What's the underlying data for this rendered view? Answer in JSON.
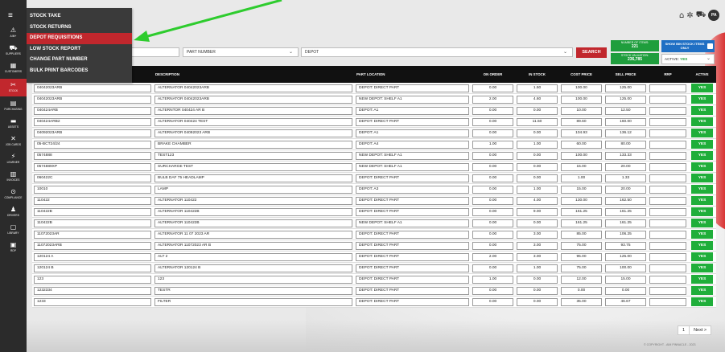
{
  "sidebar": {
    "items": [
      {
        "icon": "⚠",
        "label": "AIM+"
      },
      {
        "icon": "⛟",
        "label": "SUPPLIERS"
      },
      {
        "icon": "▦",
        "label": "CUSTOMERS"
      },
      {
        "icon": "✂",
        "label": "STOCK"
      },
      {
        "icon": "▤",
        "label": "PURCHASING"
      },
      {
        "icon": "▬",
        "label": "ASSETS"
      },
      {
        "icon": "✕",
        "label": "JOB CARDS"
      },
      {
        "icon": "⚡",
        "label": "LEARNER"
      },
      {
        "icon": "▥",
        "label": "INVOICES"
      },
      {
        "icon": "⊙",
        "label": "COMPLIANCE"
      },
      {
        "icon": "♟",
        "label": "DRIVERS"
      },
      {
        "icon": "▢",
        "label": "LIBRARY"
      },
      {
        "icon": "▣",
        "label": "RDP"
      }
    ]
  },
  "stock_menu": {
    "items": [
      "STOCK TAKE",
      "STOCK RETURNS",
      "DEPOT REQUISITIONS",
      "LOW STOCK REPORT",
      "CHANGE PART NUMBER",
      "BULK PRINT BARCODES"
    ],
    "highlighted_index": 2
  },
  "header": {
    "avatar_initials": "PA",
    "icons": [
      "home-icon",
      "settings-icon",
      "truck-icon"
    ]
  },
  "filters": {
    "part_number_placeholder": "PART NUMBER",
    "depot_value": "DEPOT",
    "search_label": "SEARCH"
  },
  "summary": {
    "num_items_label": "NUMBER OF ITEMS:",
    "num_items_value": "221",
    "stock_valuation_label": "STOCK VALUATION:",
    "stock_valuation_value": "236,785",
    "bin_stock_label": "SHOW BIN STOCK ITEMS ONLY",
    "active_label": "ACTIVE:",
    "active_value": "YES"
  },
  "colors": {
    "accent_red": "#c1272d",
    "active_green": "#1fae3a",
    "sidebar_dark": "#2b2b2b",
    "arrow_green": "#2ecc2e"
  },
  "table": {
    "headers": [
      "DESCRIPTION",
      "PART LOCATION",
      "ON ORDER",
      "IN STOCK",
      "COST PRICE",
      "SELL PRICE",
      "RRP",
      "ACTIVE"
    ],
    "rows": [
      [
        "04042023ARB",
        "ALTERNATOR 04042023ARB",
        "DEPOT: DIRECT PART",
        "0.00",
        "1.50",
        "100.00",
        "125.00",
        "",
        "YES"
      ],
      [
        "04042023ARB",
        "ALTERNATOR 04042023ARB",
        "NEW DEPOT: SHELF A1",
        "2.00",
        "4.60",
        "100.00",
        "125.00",
        "",
        "YES"
      ],
      [
        "040424ARB",
        "ALTERNTOR 040424 AR B",
        "DEPOT: A1",
        "0.00",
        "0.00",
        "10.00",
        "12.50",
        "",
        "YES"
      ],
      [
        "040424ARB2",
        "ALTERNATOR 040424 TEST",
        "DEPOT: DIRECT PART",
        "0.00",
        "11.50",
        "89.60",
        "160.00",
        "",
        "YES"
      ],
      [
        "04092023ARB",
        "ALTERNATOR 04092023 ARB",
        "DEPOT: A1",
        "0.00",
        "0.00",
        "104.93",
        "136.12",
        "",
        "YES"
      ],
      [
        "05-BCT24/24",
        "BRAKE CHAMBER",
        "DEPOT: A4",
        "1.00",
        "1.00",
        "60.00",
        "80.00",
        "",
        "YES"
      ],
      [
        "0574888",
        "TEST123",
        "NEW DEPOT: SHELF A1",
        "0.00",
        "0.00",
        "100.00",
        "133.33",
        "",
        "YES"
      ],
      [
        "0574889XP",
        "SURCHARGE TEST",
        "NEW DEPOT: SHELF A1",
        "0.00",
        "0.00",
        "15.00",
        "20.00",
        "",
        "YES"
      ],
      [
        "060422C",
        "BULB DAF 75 HEADLAMP",
        "DEPOT: DIRECT PART",
        "0.00",
        "0.00",
        "1.00",
        "1.33",
        "",
        "YES"
      ],
      [
        "10010",
        "LAMP",
        "DEPOT: A3",
        "0.00",
        "1.00",
        "15.00",
        "20.00",
        "",
        "YES"
      ],
      [
        "110422",
        "ALTERNATOR 110422",
        "DEPOT: DIRECT PART",
        "0.00",
        "4.00",
        "130.00",
        "162.50",
        "",
        "YES"
      ],
      [
        "110422B",
        "ALTERNATOR 110422B",
        "DEPOT: DIRECT PART",
        "0.00",
        "9.00",
        "161.25",
        "161.25",
        "",
        "YES"
      ],
      [
        "110422B",
        "ALTERNATOR 110422B",
        "NEW DEPOT: SHELF A1",
        "0.00",
        "0.00",
        "161.25",
        "161.25",
        "",
        "YES"
      ],
      [
        "11072023AR",
        "ALTERNATOR 11 07 2023 AR",
        "DEPOT: DIRECT PART",
        "0.00",
        "3.00",
        "85.00",
        "106.25",
        "",
        "YES"
      ],
      [
        "11072023ARB",
        "ALTERNATOR 11072023 AR B",
        "DEPOT: DIRECT PART",
        "0.00",
        "3.00",
        "75.00",
        "93.75",
        "",
        "YES"
      ],
      [
        "120124 A",
        "ALT 2",
        "DEPOT: DIRECT PART",
        "2.00",
        "3.00",
        "95.00",
        "125.00",
        "",
        "YES"
      ],
      [
        "120124 B",
        "ALTERNATOR 120124 B",
        "DEPOT: DIRECT PART",
        "0.00",
        "1.00",
        "75.00",
        "100.00",
        "",
        "YES"
      ],
      [
        "123",
        "123",
        "DEPOT: DIRECT PART",
        "1.00",
        "0.00",
        "12.00",
        "15.00",
        "",
        "YES"
      ],
      [
        "1232334",
        "TESTR",
        "DEPOT: DIRECT PART",
        "0.00",
        "0.00",
        "0.00",
        "0.00",
        "",
        "YES"
      ],
      [
        "1233",
        "FILTER",
        "DEPOT: DIRECT PART",
        "0.00",
        "0.00",
        "35.00",
        "46.67",
        "",
        "YES"
      ]
    ]
  },
  "pagination": {
    "current": "1",
    "next_label": "Next >"
  },
  "footer": {
    "copyright": "© COPYRIGHT - AIM PINNACLE - 2023"
  }
}
